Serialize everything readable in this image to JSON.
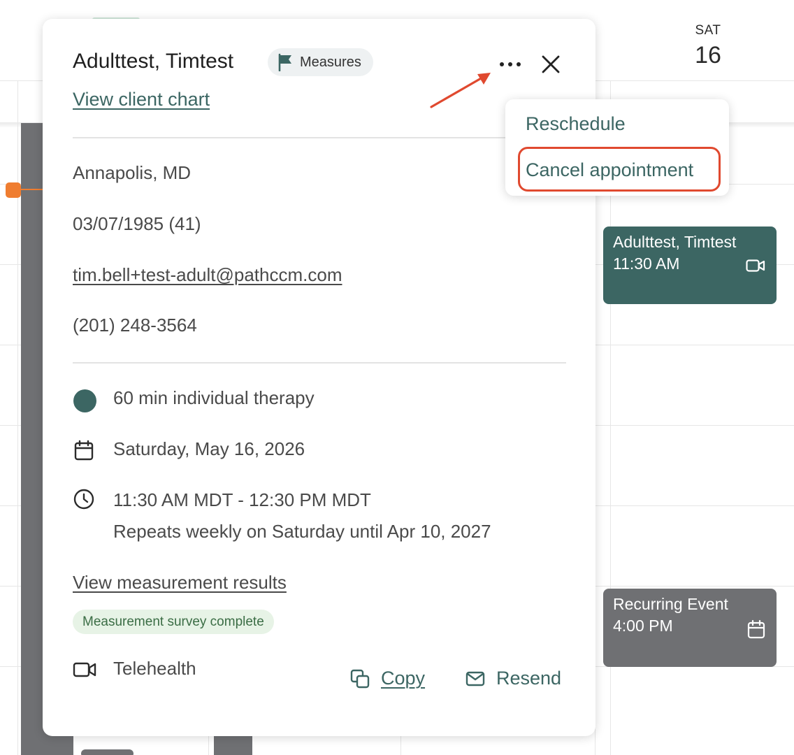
{
  "calendar": {
    "day_label": "SAT",
    "day_number": "16",
    "events": [
      {
        "title": "Adulttest, Timtest",
        "time": "11:30 AM",
        "icon": "video-icon",
        "color": "#3c6663"
      },
      {
        "title": "Recurring Event",
        "time": "4:00 PM",
        "icon": "calendar-icon",
        "color": "#6f7073"
      }
    ],
    "now_indicator_color": "#ef7d30"
  },
  "popover": {
    "client_name": "Adulttest, Timtest",
    "measures_label": "Measures",
    "view_chart_link": "View client chart",
    "location": "Annapolis, MD",
    "dob": "03/07/1985 (41)",
    "email": "tim.bell+test-adult@pathccm.com",
    "phone": "(201) 248-3564",
    "appointment_type": "60 min individual therapy",
    "appointment_type_color": "#3c6663",
    "date": "Saturday, May 16, 2026",
    "time_range": "11:30 AM MDT - 12:30 PM MDT",
    "recurrence": "Repeats weekly on Saturday until Apr 10, 2027",
    "measurement_link": "View measurement results",
    "survey_status": "Measurement survey complete",
    "location_type": "Telehealth",
    "copy_label": "Copy",
    "resend_label": "Resend"
  },
  "menu": {
    "items": [
      "Reschedule",
      "Cancel appointment"
    ]
  },
  "colors": {
    "accent": "#3c6663",
    "annotation": "#e0492f",
    "success_bg": "#e7f3e6",
    "success_text": "#3b6d45"
  }
}
